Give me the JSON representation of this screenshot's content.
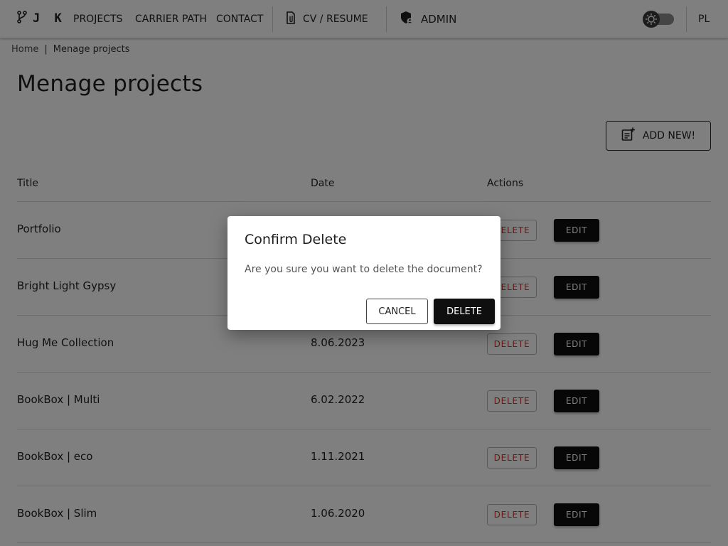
{
  "header": {
    "logo_text": "J K",
    "logo_icon": "git-branch-icon",
    "nav": {
      "projects": "PROJECTS",
      "carrier_path": "CARRIER PATH",
      "contact": "CONTACT",
      "cv": "CV / RESUME",
      "admin": "ADMIN"
    },
    "cv_icon": "document-icon",
    "admin_icon": "shield-user-icon",
    "theme_toggle_icon": "sun-icon",
    "language": "PL"
  },
  "breadcrumb": {
    "home": "Home",
    "separator": "|",
    "current": "Menage projects"
  },
  "page": {
    "title": "Menage projects",
    "add_button_label": "ADD NEW!",
    "add_icon": "add-document-icon"
  },
  "table": {
    "columns": [
      "Title",
      "Date",
      "Actions"
    ],
    "delete_label": "DELETE",
    "edit_label": "EDIT",
    "rows": [
      {
        "title": "Portfolio",
        "date": ""
      },
      {
        "title": "Bright Light Gypsy",
        "date": ""
      },
      {
        "title": "Hug Me Collection",
        "date": "8.06.2023"
      },
      {
        "title": "BookBox | Multi",
        "date": "6.02.2022"
      },
      {
        "title": "BookBox | eco",
        "date": "1.11.2021"
      },
      {
        "title": "BookBox | Slim",
        "date": "1.06.2020"
      }
    ]
  },
  "dialog": {
    "title": "Confirm Delete",
    "message": "Are you sure you want to delete the document?",
    "cancel_label": "CANCEL",
    "confirm_label": "DELETE"
  },
  "colors": {
    "accent_dark": "#0f0f0f",
    "delete_text": "#c0392b",
    "overlay": "rgba(0,0,0,0.5)"
  }
}
